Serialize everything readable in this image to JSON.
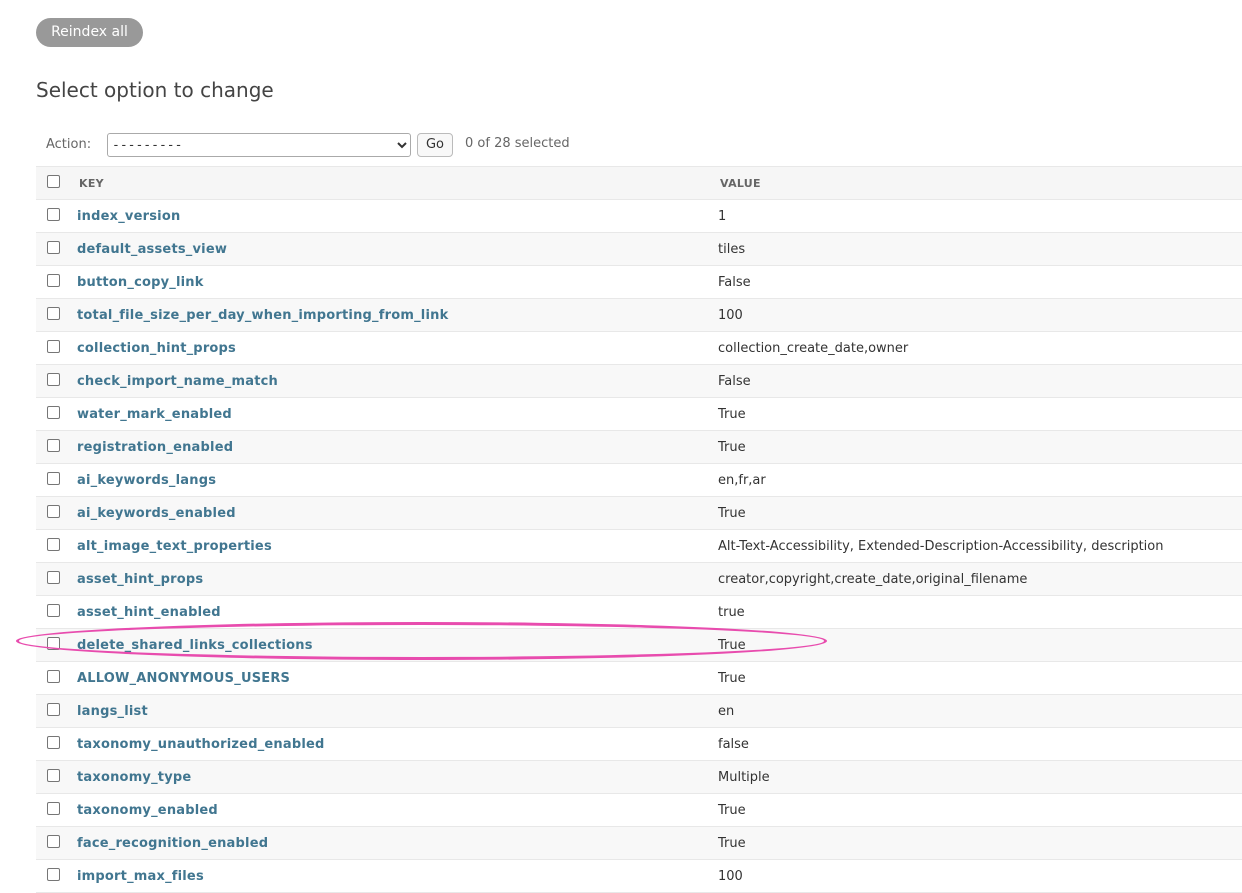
{
  "reindex_button": "Reindex all",
  "page_title": "Select option to change",
  "actions": {
    "label": "Action:",
    "select_value": "---------",
    "go_label": "Go",
    "selected_count": "0 of 28 selected"
  },
  "table": {
    "headers": {
      "key": "KEY",
      "value": "VALUE"
    },
    "rows": [
      {
        "key": "index_version",
        "value": "1"
      },
      {
        "key": "default_assets_view",
        "value": "tiles"
      },
      {
        "key": "button_copy_link",
        "value": "False"
      },
      {
        "key": "total_file_size_per_day_when_importing_from_link",
        "value": "100"
      },
      {
        "key": "collection_hint_props",
        "value": "collection_create_date,owner"
      },
      {
        "key": "check_import_name_match",
        "value": "False"
      },
      {
        "key": "water_mark_enabled",
        "value": "True"
      },
      {
        "key": "registration_enabled",
        "value": "True"
      },
      {
        "key": "ai_keywords_langs",
        "value": "en,fr,ar"
      },
      {
        "key": "ai_keywords_enabled",
        "value": "True"
      },
      {
        "key": "alt_image_text_properties",
        "value": "Alt-Text-Accessibility, Extended-Description-Accessibility, description"
      },
      {
        "key": "asset_hint_props",
        "value": "creator,copyright,create_date,original_filename"
      },
      {
        "key": "asset_hint_enabled",
        "value": "true"
      },
      {
        "key": "delete_shared_links_collections",
        "value": "True"
      },
      {
        "key": "ALLOW_ANONYMOUS_USERS",
        "value": "True"
      },
      {
        "key": "langs_list",
        "value": "en"
      },
      {
        "key": "taxonomy_unauthorized_enabled",
        "value": "false"
      },
      {
        "key": "taxonomy_type",
        "value": "Multiple"
      },
      {
        "key": "taxonomy_enabled",
        "value": "True"
      },
      {
        "key": "face_recognition_enabled",
        "value": "True"
      },
      {
        "key": "import_max_files",
        "value": "100"
      }
    ]
  },
  "highlight": {
    "row_key": "delete_shared_links_collections",
    "color": "#e84cae"
  },
  "colors": {
    "link": "#417690",
    "button_gray": "#999999"
  }
}
